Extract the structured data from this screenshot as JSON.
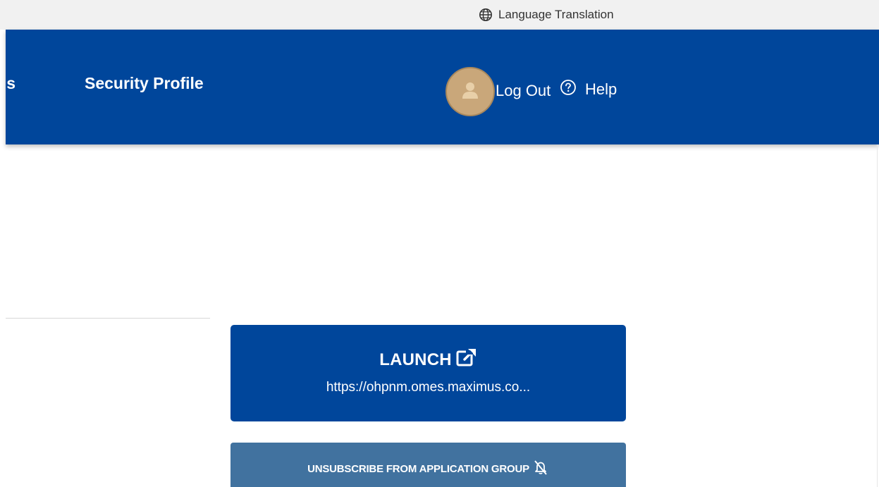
{
  "topbar": {
    "language_label": "Language Translation",
    "language_icon": "globe-icon"
  },
  "header": {
    "nav_partial_label": "s",
    "nav_security_label": "Security Profile",
    "avatar_icon": "user-icon",
    "logout_label": "Log Out",
    "help_icon": "question-circle-icon",
    "help_label": "Help"
  },
  "main": {
    "launch": {
      "title": "LAUNCH",
      "icon": "external-link-icon",
      "url": "https://ohpnm.omes.maximus.co..."
    },
    "unsubscribe": {
      "label": "UNSUBSCRIBE FROM APPLICATION GROUP",
      "icon": "bell-slash-icon"
    }
  },
  "colors": {
    "header_bg": "#00469b",
    "topbar_bg": "#f1f1f1",
    "launch_bg": "#00469b",
    "unsubscribe_bg": "#41729f",
    "avatar_bg": "#c9a77a"
  }
}
